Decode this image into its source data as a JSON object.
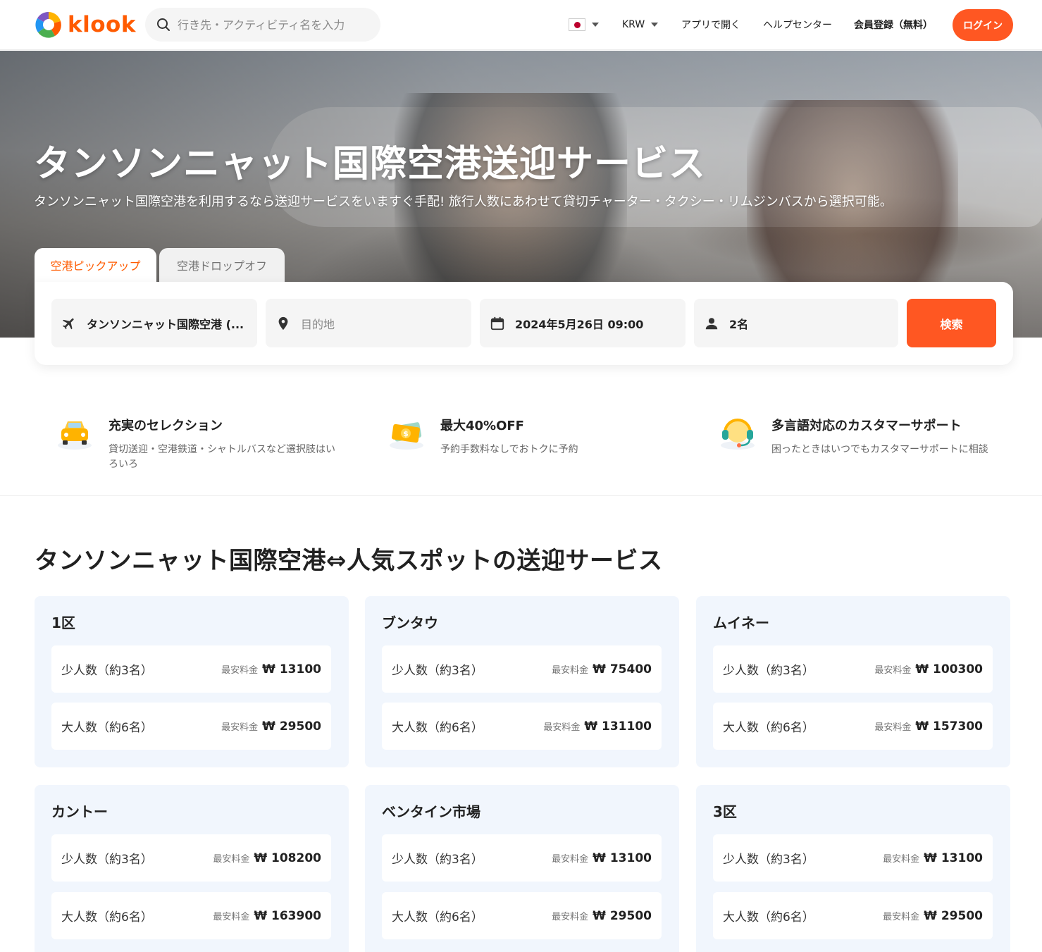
{
  "header": {
    "logo_text": "klook",
    "search_placeholder": "行き先・アクティビティ名を入力",
    "currency": "KRW",
    "open_app": "アプリで開く",
    "help_center": "ヘルプセンター",
    "signup": "会員登録（無料）",
    "login": "ログイン"
  },
  "hero": {
    "title": "タンソンニャット国際空港送迎サービス",
    "subtitle": "タンソンニャット国際空港を利用するなら送迎サービスをいますぐ手配! 旅行人数にあわせて貸切チャーター・タクシー・リムジンバスから選択可能。"
  },
  "tabs": [
    {
      "label": "空港ピックアップ"
    },
    {
      "label": "空港ドロップオフ"
    }
  ],
  "search_form": {
    "airport": "タンソンニャット国際空港 (...",
    "destination_placeholder": "目的地",
    "datetime": "2024年5月26日 09:00",
    "passengers": "2名",
    "search_button": "検索"
  },
  "features": [
    {
      "title": "充実のセレクション",
      "desc": "貸切送迎・空港鉄道・シャトルバスなど選択肢はいろいろ"
    },
    {
      "title": "最大40%OFF",
      "desc": "予約手数料なしでおトクに予約"
    },
    {
      "title": "多言語対応のカスタマーサポート",
      "desc": "困ったときはいつでもカスタマーサポートに相談"
    }
  ],
  "section": {
    "title": "タンソンニャット国際空港⇔人気スポットの送迎サービス",
    "min_price_label": "最安料金",
    "cards": [
      {
        "title": "1区",
        "rows": [
          {
            "label": "少人数（約3名）",
            "price": "₩ 13100"
          },
          {
            "label": "大人数（約6名）",
            "price": "₩ 29500"
          }
        ]
      },
      {
        "title": "ブンタウ",
        "rows": [
          {
            "label": "少人数（約3名）",
            "price": "₩ 75400"
          },
          {
            "label": "大人数（約6名）",
            "price": "₩ 131100"
          }
        ]
      },
      {
        "title": "ムイネー",
        "rows": [
          {
            "label": "少人数（約3名）",
            "price": "₩ 100300"
          },
          {
            "label": "大人数（約6名）",
            "price": "₩ 157300"
          }
        ]
      },
      {
        "title": "カントー",
        "rows": [
          {
            "label": "少人数（約3名）",
            "price": "₩ 108200"
          },
          {
            "label": "大人数（約6名）",
            "price": "₩ 163900"
          }
        ]
      },
      {
        "title": "ベンタイン市場",
        "rows": [
          {
            "label": "少人数（約3名）",
            "price": "₩ 13100"
          },
          {
            "label": "大人数（約6名）",
            "price": "₩ 29500"
          }
        ]
      },
      {
        "title": "3区",
        "rows": [
          {
            "label": "少人数（約3名）",
            "price": "₩ 13100"
          },
          {
            "label": "大人数（約6名）",
            "price": "₩ 29500"
          }
        ]
      }
    ]
  },
  "colors": {
    "brand": "#ff5b00",
    "button": "#ff5722",
    "card_bg": "#f1f6fd"
  },
  "icons": [
    "klook-logo-icon",
    "search-icon",
    "japan-flag-icon",
    "chevron-down-icon",
    "plane-icon",
    "location-pin-icon",
    "calendar-icon",
    "person-icon",
    "car-icon",
    "money-icon",
    "headset-icon"
  ]
}
